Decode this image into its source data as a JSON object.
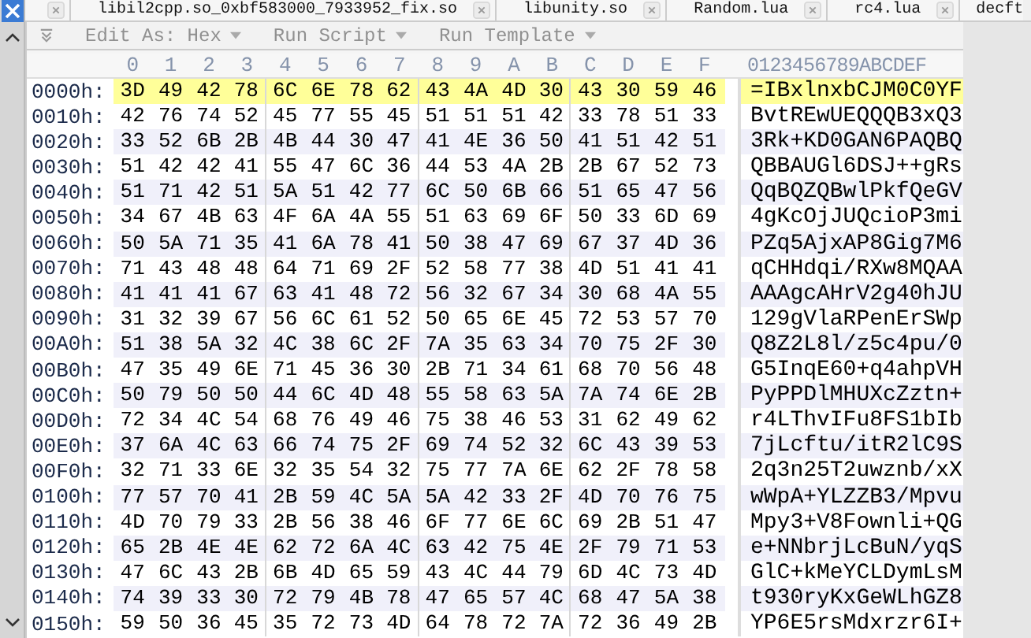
{
  "tabs": [
    {
      "kind": "partial"
    },
    {
      "kind": "full",
      "label": "libil2cpp.so_0xbf583000_7933952_fix.so"
    },
    {
      "kind": "full",
      "label": "libunity.so"
    },
    {
      "kind": "full",
      "label": "Random.lua"
    },
    {
      "kind": "full",
      "label": "rc4.lua"
    },
    {
      "kind": "cut",
      "label": "decft"
    }
  ],
  "toolbar": [
    {
      "label": "Edit As: Hex"
    },
    {
      "label": "Run Script"
    },
    {
      "label": "Run Template"
    }
  ],
  "header": {
    "columns": [
      "0",
      "1",
      "2",
      "3",
      "4",
      "5",
      "6",
      "7",
      "8",
      "9",
      "A",
      "B",
      "C",
      "D",
      "E",
      "F"
    ],
    "ascii": "0123456789ABCDEF"
  },
  "rows": [
    {
      "address": "0000h:",
      "bytes": [
        "3D",
        "49",
        "42",
        "78",
        "6C",
        "6E",
        "78",
        "62",
        "43",
        "4A",
        "4D",
        "30",
        "43",
        "30",
        "59",
        "46"
      ],
      "ascii": "=IBxlnxbCJM0C0YF",
      "selected": true
    },
    {
      "address": "0010h:",
      "bytes": [
        "42",
        "76",
        "74",
        "52",
        "45",
        "77",
        "55",
        "45",
        "51",
        "51",
        "51",
        "42",
        "33",
        "78",
        "51",
        "33"
      ],
      "ascii": "BvtREwUEQQQB3xQ3",
      "selected": false
    },
    {
      "address": "0020h:",
      "bytes": [
        "33",
        "52",
        "6B",
        "2B",
        "4B",
        "44",
        "30",
        "47",
        "41",
        "4E",
        "36",
        "50",
        "41",
        "51",
        "42",
        "51"
      ],
      "ascii": "3Rk+KD0GAN6PAQBQ",
      "selected": false
    },
    {
      "address": "0030h:",
      "bytes": [
        "51",
        "42",
        "42",
        "41",
        "55",
        "47",
        "6C",
        "36",
        "44",
        "53",
        "4A",
        "2B",
        "2B",
        "67",
        "52",
        "73"
      ],
      "ascii": "QBBAUGl6DSJ++gRs",
      "selected": false
    },
    {
      "address": "0040h:",
      "bytes": [
        "51",
        "71",
        "42",
        "51",
        "5A",
        "51",
        "42",
        "77",
        "6C",
        "50",
        "6B",
        "66",
        "51",
        "65",
        "47",
        "56"
      ],
      "ascii": "QqBQZQBwlPkfQeGV",
      "selected": false
    },
    {
      "address": "0050h:",
      "bytes": [
        "34",
        "67",
        "4B",
        "63",
        "4F",
        "6A",
        "4A",
        "55",
        "51",
        "63",
        "69",
        "6F",
        "50",
        "33",
        "6D",
        "69"
      ],
      "ascii": "4gKcOjJUQcioP3mi",
      "selected": false
    },
    {
      "address": "0060h:",
      "bytes": [
        "50",
        "5A",
        "71",
        "35",
        "41",
        "6A",
        "78",
        "41",
        "50",
        "38",
        "47",
        "69",
        "67",
        "37",
        "4D",
        "36"
      ],
      "ascii": "PZq5AjxAP8Gig7M6",
      "selected": false
    },
    {
      "address": "0070h:",
      "bytes": [
        "71",
        "43",
        "48",
        "48",
        "64",
        "71",
        "69",
        "2F",
        "52",
        "58",
        "77",
        "38",
        "4D",
        "51",
        "41",
        "41"
      ],
      "ascii": "qCHHdqi/RXw8MQAA",
      "selected": false
    },
    {
      "address": "0080h:",
      "bytes": [
        "41",
        "41",
        "41",
        "67",
        "63",
        "41",
        "48",
        "72",
        "56",
        "32",
        "67",
        "34",
        "30",
        "68",
        "4A",
        "55"
      ],
      "ascii": "AAAgcAHrV2g40hJU",
      "selected": false
    },
    {
      "address": "0090h:",
      "bytes": [
        "31",
        "32",
        "39",
        "67",
        "56",
        "6C",
        "61",
        "52",
        "50",
        "65",
        "6E",
        "45",
        "72",
        "53",
        "57",
        "70"
      ],
      "ascii": "129gVlaRPenErSWp",
      "selected": false
    },
    {
      "address": "00A0h:",
      "bytes": [
        "51",
        "38",
        "5A",
        "32",
        "4C",
        "38",
        "6C",
        "2F",
        "7A",
        "35",
        "63",
        "34",
        "70",
        "75",
        "2F",
        "30"
      ],
      "ascii": "Q8Z2L8l/z5c4pu/0",
      "selected": false
    },
    {
      "address": "00B0h:",
      "bytes": [
        "47",
        "35",
        "49",
        "6E",
        "71",
        "45",
        "36",
        "30",
        "2B",
        "71",
        "34",
        "61",
        "68",
        "70",
        "56",
        "48"
      ],
      "ascii": "G5InqE60+q4ahpVH",
      "selected": false
    },
    {
      "address": "00C0h:",
      "bytes": [
        "50",
        "79",
        "50",
        "50",
        "44",
        "6C",
        "4D",
        "48",
        "55",
        "58",
        "63",
        "5A",
        "7A",
        "74",
        "6E",
        "2B"
      ],
      "ascii": "PyPPDlMHUXcZztn+",
      "selected": false
    },
    {
      "address": "00D0h:",
      "bytes": [
        "72",
        "34",
        "4C",
        "54",
        "68",
        "76",
        "49",
        "46",
        "75",
        "38",
        "46",
        "53",
        "31",
        "62",
        "49",
        "62"
      ],
      "ascii": "r4LThvIFu8FS1bIb",
      "selected": false
    },
    {
      "address": "00E0h:",
      "bytes": [
        "37",
        "6A",
        "4C",
        "63",
        "66",
        "74",
        "75",
        "2F",
        "69",
        "74",
        "52",
        "32",
        "6C",
        "43",
        "39",
        "53"
      ],
      "ascii": "7jLcftu/itR2lC9S",
      "selected": false
    },
    {
      "address": "00F0h:",
      "bytes": [
        "32",
        "71",
        "33",
        "6E",
        "32",
        "35",
        "54",
        "32",
        "75",
        "77",
        "7A",
        "6E",
        "62",
        "2F",
        "78",
        "58"
      ],
      "ascii": "2q3n25T2uwznb/xX",
      "selected": false
    },
    {
      "address": "0100h:",
      "bytes": [
        "77",
        "57",
        "70",
        "41",
        "2B",
        "59",
        "4C",
        "5A",
        "5A",
        "42",
        "33",
        "2F",
        "4D",
        "70",
        "76",
        "75"
      ],
      "ascii": "wWpA+YLZZB3/Mpvu",
      "selected": false
    },
    {
      "address": "0110h:",
      "bytes": [
        "4D",
        "70",
        "79",
        "33",
        "2B",
        "56",
        "38",
        "46",
        "6F",
        "77",
        "6E",
        "6C",
        "69",
        "2B",
        "51",
        "47"
      ],
      "ascii": "Mpy3+V8Fownli+QG",
      "selected": false
    },
    {
      "address": "0120h:",
      "bytes": [
        "65",
        "2B",
        "4E",
        "4E",
        "62",
        "72",
        "6A",
        "4C",
        "63",
        "42",
        "75",
        "4E",
        "2F",
        "79",
        "71",
        "53"
      ],
      "ascii": "e+NNbrjLcBuN/yqS",
      "selected": false
    },
    {
      "address": "0130h:",
      "bytes": [
        "47",
        "6C",
        "43",
        "2B",
        "6B",
        "4D",
        "65",
        "59",
        "43",
        "4C",
        "44",
        "79",
        "6D",
        "4C",
        "73",
        "4D"
      ],
      "ascii": "GlC+kMeYCLDymLsM",
      "selected": false
    },
    {
      "address": "0140h:",
      "bytes": [
        "74",
        "39",
        "33",
        "30",
        "72",
        "79",
        "4B",
        "78",
        "47",
        "65",
        "57",
        "4C",
        "68",
        "47",
        "5A",
        "38"
      ],
      "ascii": "t930ryKxGeWLhGZ8",
      "selected": false
    },
    {
      "address": "0150h:",
      "bytes": [
        "59",
        "50",
        "36",
        "45",
        "35",
        "72",
        "73",
        "4D",
        "64",
        "78",
        "72",
        "7A",
        "72",
        "36",
        "49",
        "2B"
      ],
      "ascii": "YP6E5rsMdxrzr6I+",
      "selected": false
    }
  ]
}
